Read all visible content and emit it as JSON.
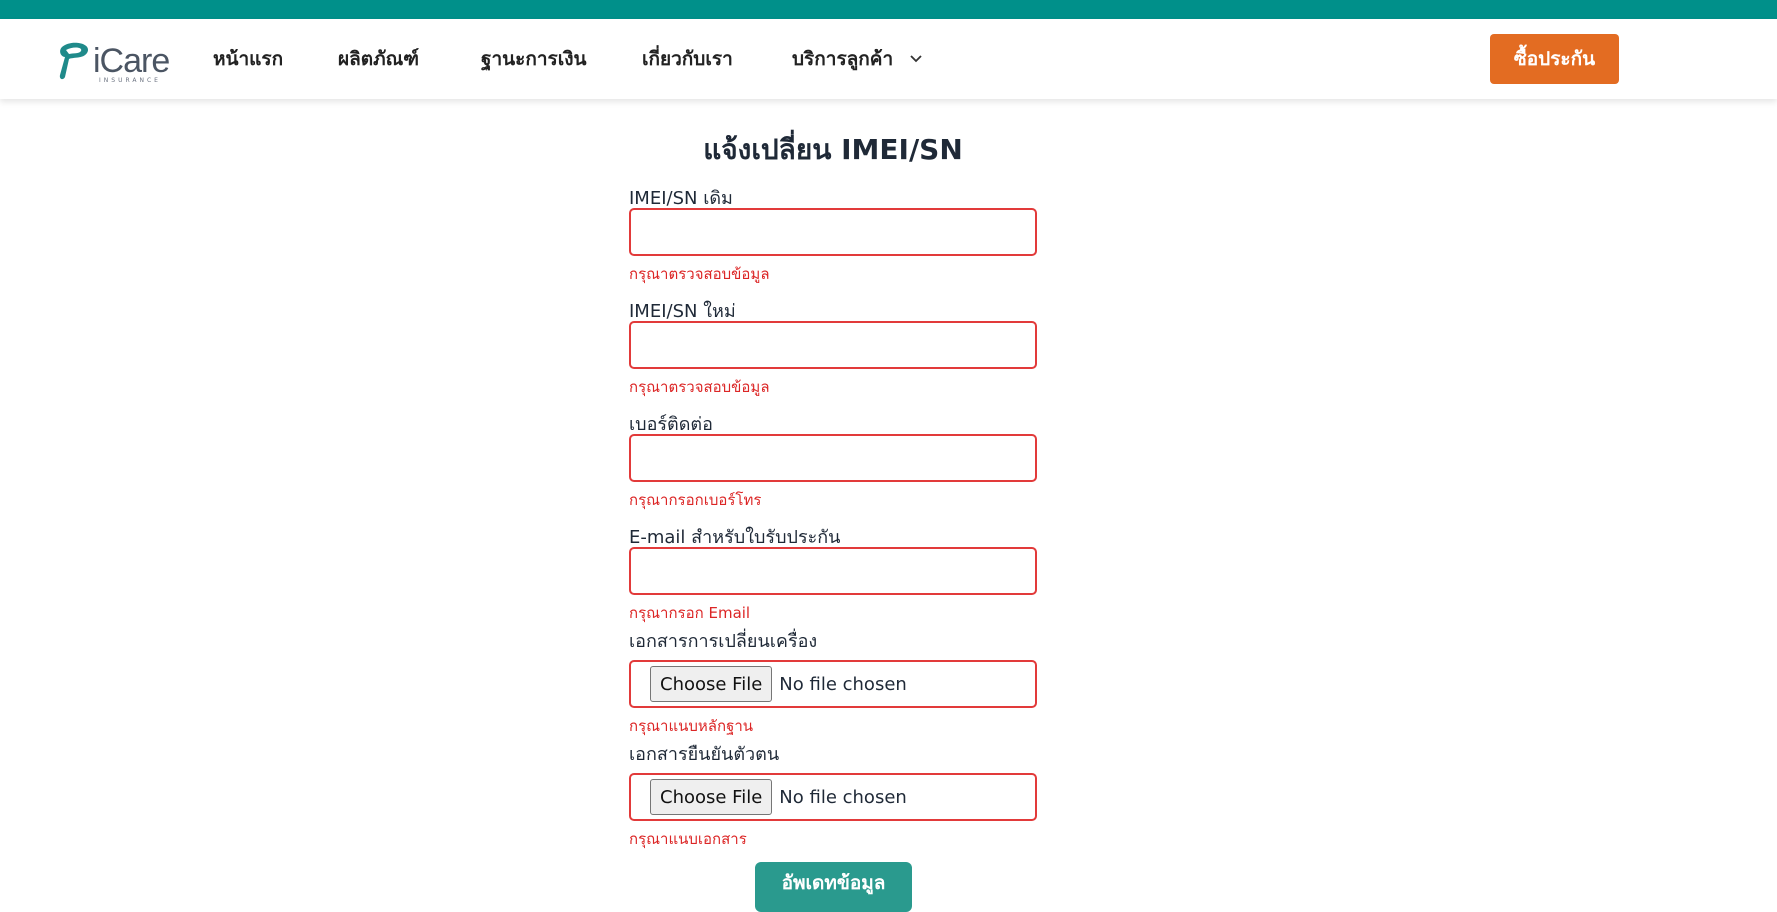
{
  "brand": {
    "name": "iCare",
    "tagline": "INSURANCE",
    "primary_color": "#00908a",
    "accent_color": "#e36c22"
  },
  "nav": {
    "items": [
      {
        "label": "หน้าแรก"
      },
      {
        "label": "ผลิตภัณฑ์"
      },
      {
        "label": "ฐานะการเงิน"
      },
      {
        "label": "เกี่ยวกับเรา"
      },
      {
        "label": "บริการลูกค้า",
        "has_dropdown": true
      }
    ],
    "cta_label": "ซื้อประกัน"
  },
  "form": {
    "title": "แจ้งเปลี่ยน IMEI/SN",
    "fields": [
      {
        "label": "IMEI/SN เดิม",
        "type": "text",
        "value": "",
        "error": "กรุณาตรวจสอบข้อมูล"
      },
      {
        "label": "IMEI/SN ใหม่",
        "type": "text",
        "value": "",
        "error": "กรุณาตรวจสอบข้อมูล"
      },
      {
        "label": "เบอร์ติดต่อ",
        "type": "tel",
        "value": "",
        "error": "กรุณากรอกเบอร์โทร"
      },
      {
        "label": "E-mail สำหรับใบรับประกัน",
        "type": "email",
        "value": "",
        "error": "กรุณากรอก Email"
      },
      {
        "label": "เอกสารการเปลี่ยนเครื่อง",
        "type": "file",
        "button": "Choose File",
        "status": "No file chosen",
        "error": "กรุณาแนบหลักฐาน"
      },
      {
        "label": "เอกสารยืนยันตัวตน",
        "type": "file",
        "button": "Choose File",
        "status": "No file chosen",
        "error": "กรุณาแนบเอกสาร"
      }
    ],
    "submit_label": "อัพเดทข้อมูล"
  }
}
